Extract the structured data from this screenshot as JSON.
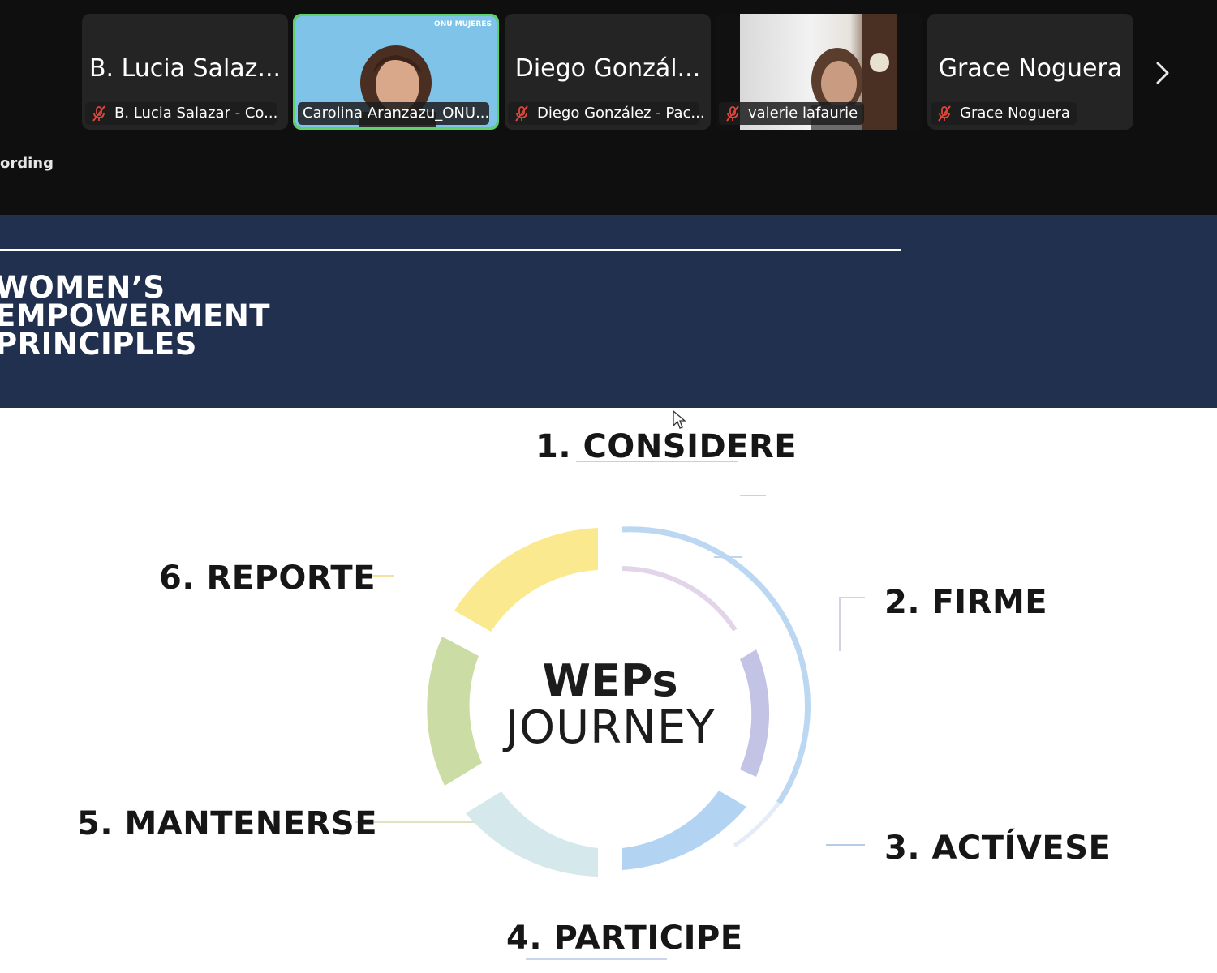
{
  "participants": [
    {
      "tile_name": "B. Lucia Salaz...",
      "label": "B. Lucia Salazar - Co...",
      "muted": true,
      "video": false,
      "active": false
    },
    {
      "tile_name": "",
      "label": "Carolina Aranzazu_ONU...",
      "muted": false,
      "video": true,
      "active": true,
      "watermark": "ONU MUJERES"
    },
    {
      "tile_name": "Diego Gonzál...",
      "label": "Diego González - Pac...",
      "muted": true,
      "video": false,
      "active": false
    },
    {
      "tile_name": "",
      "label": "valerie lafaurie",
      "muted": true,
      "video": true,
      "active": false
    },
    {
      "tile_name": "Grace Noguera",
      "label": "Grace Noguera",
      "muted": true,
      "video": false,
      "active": false
    }
  ],
  "strip": {
    "recording_text": "ording",
    "next_icon": "chevron-right-icon"
  },
  "slide": {
    "header_title_lines": [
      "WOMEN’S",
      "EMPOWERMENT",
      "PRINCIPLES"
    ],
    "center_title": "WEPs",
    "center_subtitle": "JOURNEY",
    "steps": {
      "s1": "1. CONSIDERE",
      "s2": "2. FIRME",
      "s3": "3. ACTÍVESE",
      "s4": "4. PARTICIPE",
      "s5": "5. MANTENERSE",
      "s6": "6. REPORTE"
    }
  },
  "colors": {
    "strip_bg": "#0f0f0f",
    "tile_bg": "#242424",
    "active_border": "#5bd36a",
    "mute_red": "#e0453a",
    "header_bg": "#223050",
    "seg_yellow": "#fbe98f",
    "seg_green": "#cbdca4",
    "seg_teal": "#d5e8ec",
    "seg_blue": "#b3d3f2",
    "seg_lavender": "#c3c3e6",
    "seg_pink": "#e2d5ea"
  }
}
